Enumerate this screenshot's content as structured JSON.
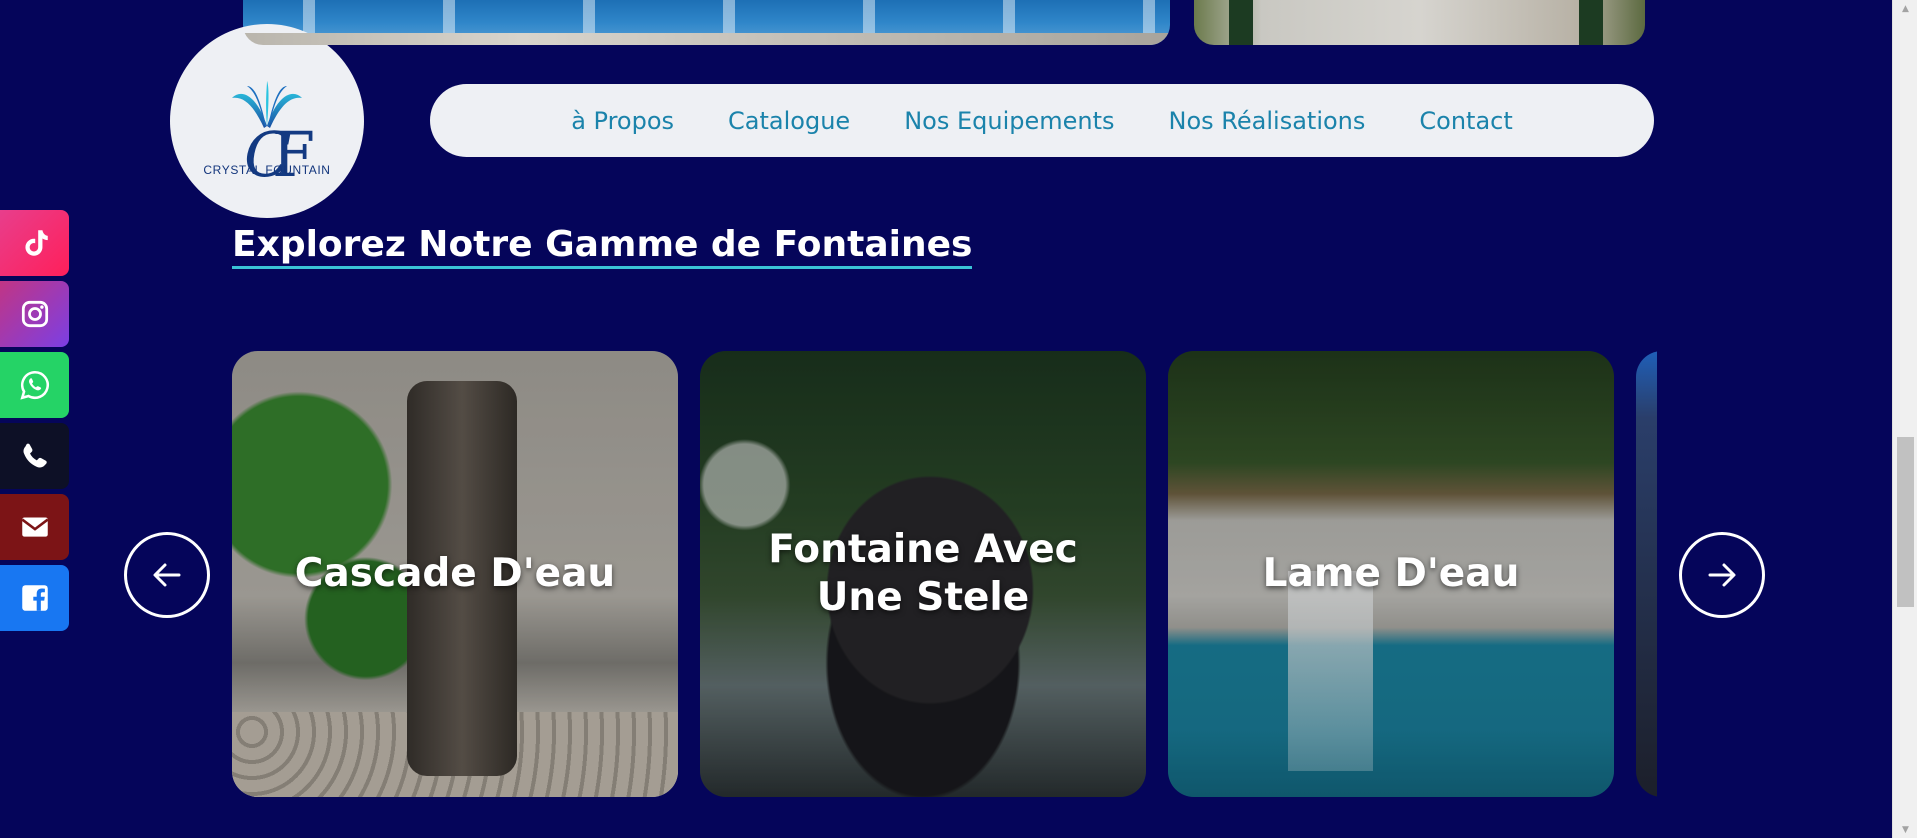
{
  "brand": {
    "logo_text": "CRYSTAL FOUNTAIN",
    "colors": {
      "background": "#05055a",
      "nav_text": "#1b83ab",
      "accent_underline": "#3ac3d6"
    }
  },
  "nav": {
    "items": [
      {
        "label": "à Propos"
      },
      {
        "label": "Catalogue"
      },
      {
        "label": "Nos Equipements"
      },
      {
        "label": "Nos Réalisations"
      },
      {
        "label": "Contact"
      }
    ]
  },
  "section": {
    "title": "Explorez Notre Gamme de Fontaines"
  },
  "carousel": {
    "cards": [
      {
        "label": "Cascade D'eau"
      },
      {
        "label": "Fontaine Avec Une Stele"
      },
      {
        "label": "Lame D'eau"
      },
      {
        "label": ""
      }
    ],
    "prev_icon": "arrow-left-icon",
    "next_icon": "arrow-right-icon"
  },
  "social": {
    "items": [
      {
        "name": "tiktok",
        "icon": "tiktok-icon",
        "color": "#ff1f5a"
      },
      {
        "name": "instagram",
        "icon": "instagram-icon",
        "color": "#c13584"
      },
      {
        "name": "whatsapp",
        "icon": "whatsapp-icon",
        "color": "#25d366"
      },
      {
        "name": "phone",
        "icon": "phone-icon",
        "color": "#0d1026"
      },
      {
        "name": "email",
        "icon": "mail-icon",
        "color": "#7c1416"
      },
      {
        "name": "facebook",
        "icon": "facebook-icon",
        "color": "#1877f2"
      }
    ]
  }
}
